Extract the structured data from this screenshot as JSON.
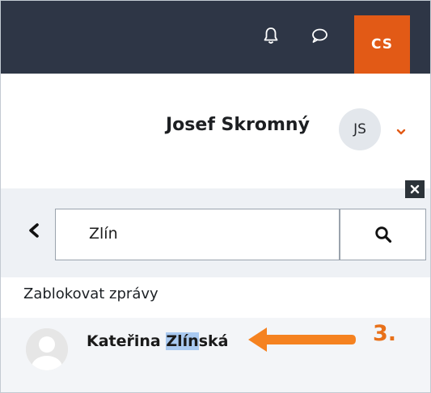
{
  "topbar": {
    "icons": [
      "bell-icon",
      "speech-bubble-icon"
    ],
    "language": "CS"
  },
  "user": {
    "name": "Josef Skromný",
    "initials": "JS",
    "menu_icon": "chevron-down-icon"
  },
  "message_panel": {
    "back_icon": "chevron-left-icon",
    "close_icon": "close-icon",
    "search": {
      "value": "Zlín",
      "icon": "search-icon"
    },
    "block_label": "Zablokovat zprávy",
    "results": [
      {
        "name_before": "Kateřina ",
        "name_match": "Zlín",
        "name_after": "ská",
        "avatar": "default-user-avatar"
      }
    ]
  },
  "annotation": {
    "step_label": "3.",
    "arrow_icon": "arrow-left-icon"
  },
  "colors": {
    "topbar_bg": "#2e3646",
    "accent_orange": "#e25a16",
    "annotation_orange": "#f58220",
    "highlight_blue": "#a9c9f0"
  }
}
